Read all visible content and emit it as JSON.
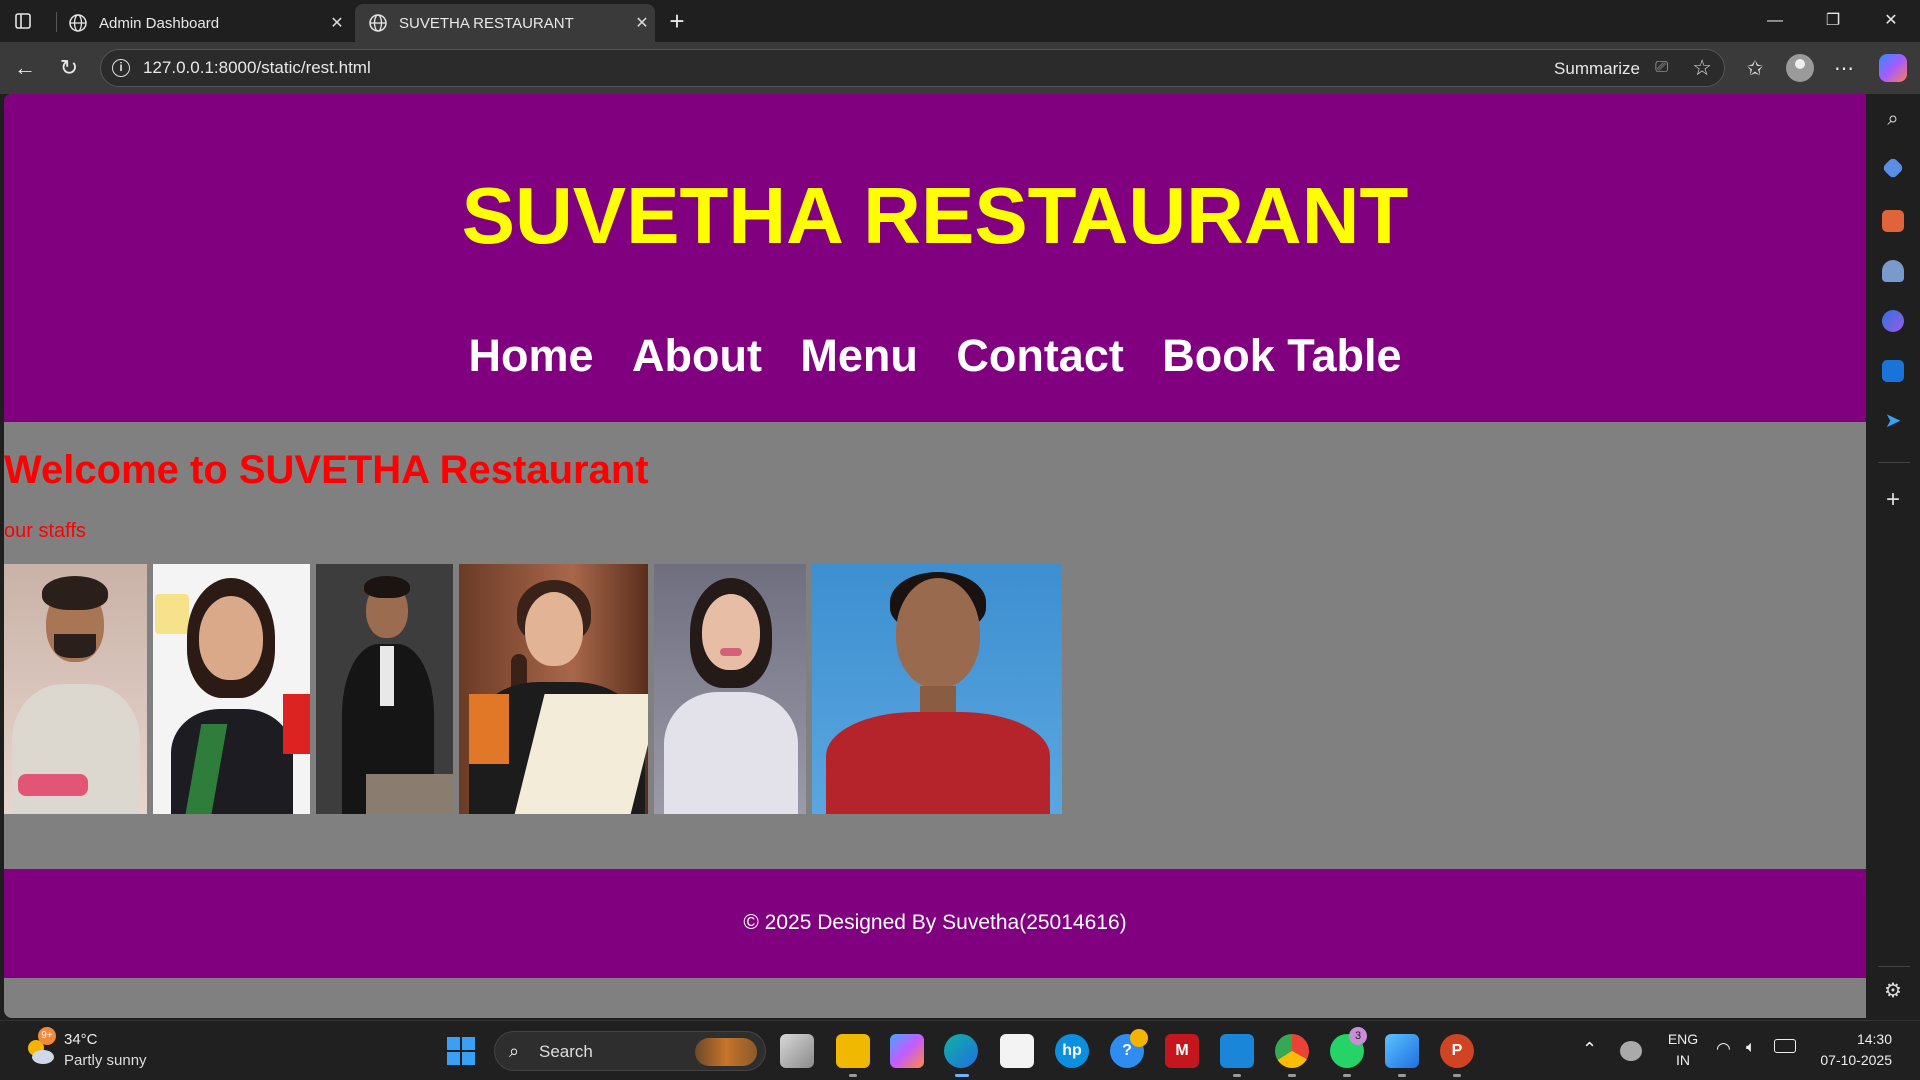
{
  "browser": {
    "tabs": [
      {
        "title": "Admin Dashboard",
        "active": false
      },
      {
        "title": "SUVETHA RESTAURANT",
        "active": true
      }
    ],
    "url": "127.0.0.1:8000/static/rest.html",
    "summarize_label": "Summarize"
  },
  "page": {
    "header": {
      "title": "SUVETHA RESTAURANT",
      "nav": [
        "Home",
        "About",
        "Menu",
        "Contact",
        "Book Table"
      ]
    },
    "welcome_heading": "Welcome to SUVETHA Restaurant",
    "staffs_label": "our staffs",
    "footer": "© 2025 Designed By Suvetha(25014616)"
  },
  "colors": {
    "header_bg": "#800080",
    "title": "#ffff00",
    "page_bg": "#808080",
    "welcome": "#ff0000"
  },
  "taskbar": {
    "weather_temp": "34°C",
    "weather_desc": "Partly sunny",
    "weather_badge": "9+",
    "search_placeholder": "Search",
    "whatsapp_badge": "3",
    "language": "ENG",
    "region": "IN",
    "time": "14:30",
    "date": "07-10-2025"
  }
}
